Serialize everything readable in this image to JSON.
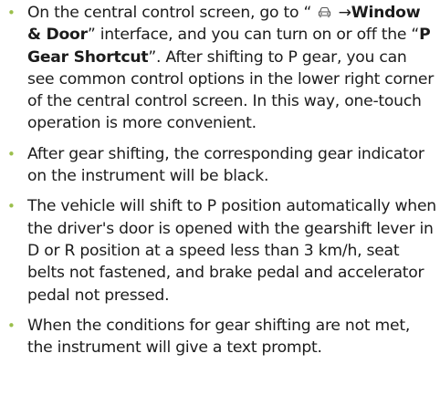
{
  "items": [
    {
      "seg1": "On the central control screen, go to “ ",
      "icon": "car-icon",
      "seg2": " →",
      "bold1": "Window & Door",
      "seg3": "” interface, and you can turn on or off the “",
      "bold2": "P Gear Shortcut",
      "seg4": "”. After shifting to P gear, you can see common control options in the lower right corner of the central control screen. In this way, one-touch operation is more convenient."
    },
    {
      "text": "After gear shifting, the corresponding gear indicator on the instrument will be black."
    },
    {
      "text": "The vehicle will shift to P position automatically when the driver's door is opened with the gearshift lever in D or R position at a speed less than 3 km/h, seat belts not fastened, and brake pedal and accelerator pedal not pressed."
    },
    {
      "text": "When the conditions for gear shifting are not met, the instrument will give a text prompt."
    }
  ],
  "bullet_glyph": "•",
  "colors": {
    "bullet": "#9bbf4c",
    "text": "#1c1c1c"
  }
}
